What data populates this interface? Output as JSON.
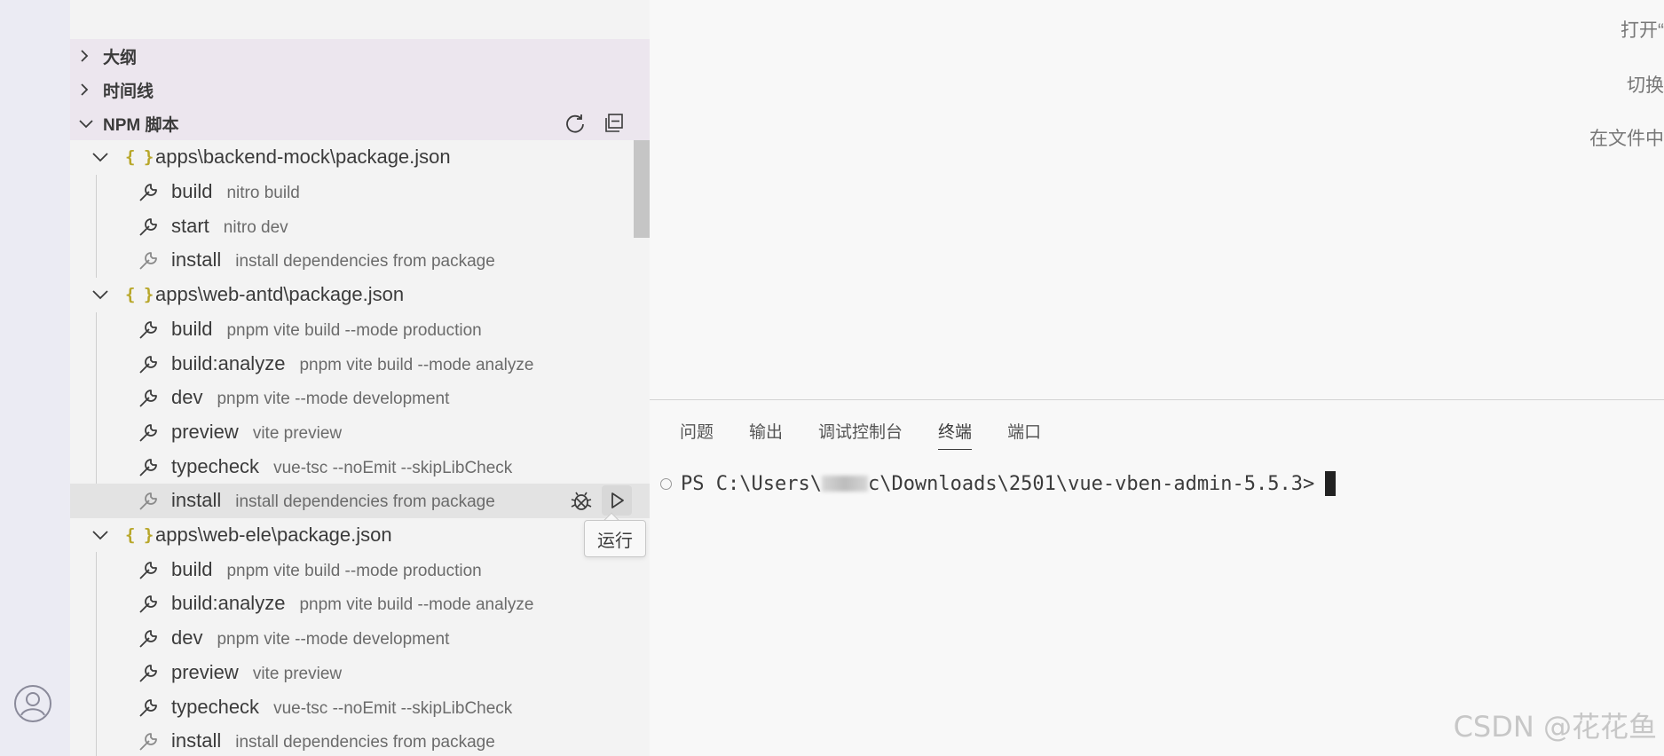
{
  "sidebar": {
    "sections": {
      "outline": "大纲",
      "timeline": "时间线",
      "npm": "NPM 脚本"
    },
    "npm_actions": [
      "refresh-icon",
      "collapse-all-icon"
    ],
    "packages": [
      {
        "label": "apps\\backend-mock\\package.json",
        "scripts": [
          {
            "name": "build",
            "cmd": "nitro build"
          },
          {
            "name": "start",
            "cmd": "nitro dev"
          },
          {
            "name": "install",
            "cmd": "install dependencies from package"
          }
        ]
      },
      {
        "label": "apps\\web-antd\\package.json",
        "scripts": [
          {
            "name": "build",
            "cmd": "pnpm vite build --mode production"
          },
          {
            "name": "build:analyze",
            "cmd": "pnpm vite build --mode analyze"
          },
          {
            "name": "dev",
            "cmd": "pnpm vite --mode development"
          },
          {
            "name": "preview",
            "cmd": "vite preview"
          },
          {
            "name": "typecheck",
            "cmd": "vue-tsc --noEmit --skipLibCheck"
          },
          {
            "name": "install",
            "cmd": "install dependencies from package"
          }
        ]
      },
      {
        "label": "apps\\web-ele\\package.json",
        "scripts": [
          {
            "name": "build",
            "cmd": "pnpm vite build --mode production"
          },
          {
            "name": "build:analyze",
            "cmd": "pnpm vite build --mode analyze"
          },
          {
            "name": "dev",
            "cmd": "pnpm vite --mode development"
          },
          {
            "name": "preview",
            "cmd": "vite preview"
          },
          {
            "name": "typecheck",
            "cmd": "vue-tsc --noEmit --skipLibCheck"
          },
          {
            "name": "install",
            "cmd": "install dependencies from package"
          }
        ]
      }
    ],
    "tooltip": "运行"
  },
  "editor": {
    "hints": [
      "打开“",
      "切换",
      "在文件中"
    ]
  },
  "panel": {
    "tabs": [
      "问题",
      "输出",
      "调试控制台",
      "终端",
      "端口"
    ],
    "active_tab": "终端",
    "terminal": {
      "prompt_prefix": "PS C:\\Users\\",
      "prompt_suffix": "c\\Downloads\\2501\\vue-vben-admin-5.5.3>"
    }
  },
  "watermark": "CSDN @花花鱼"
}
